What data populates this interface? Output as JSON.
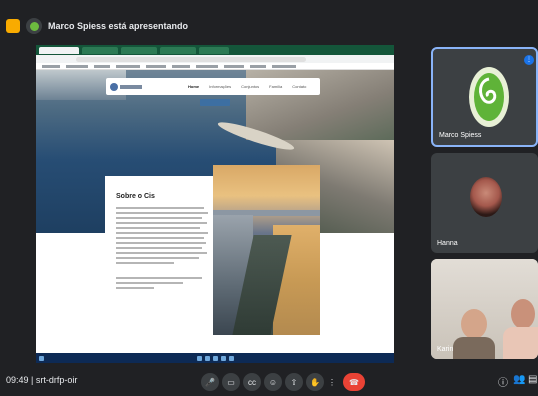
{
  "banner": {
    "text": "Marco Spiess está apresentando"
  },
  "shared_screen": {
    "site": {
      "nav_links": [
        "Home",
        "Informações",
        "Conjuntos",
        "Família",
        "Contato"
      ],
      "section_title": "Sobre o Cis"
    }
  },
  "participants": [
    {
      "name": "Marco Spiess"
    },
    {
      "name": "Hanna"
    },
    {
      "name": "Karin"
    }
  ],
  "bottom_bar": {
    "time": "09:49",
    "separator": "|",
    "meeting_code": "srt-drfp-oir",
    "controls": [
      "mic-icon",
      "camera-icon",
      "captions-icon",
      "emoji-icon",
      "present-icon",
      "raise-hand-icon",
      "more-icon",
      "end-call-icon"
    ]
  },
  "colors": {
    "accent": "#8ab4f8",
    "end_call": "#ea4335",
    "background": "#202124"
  }
}
